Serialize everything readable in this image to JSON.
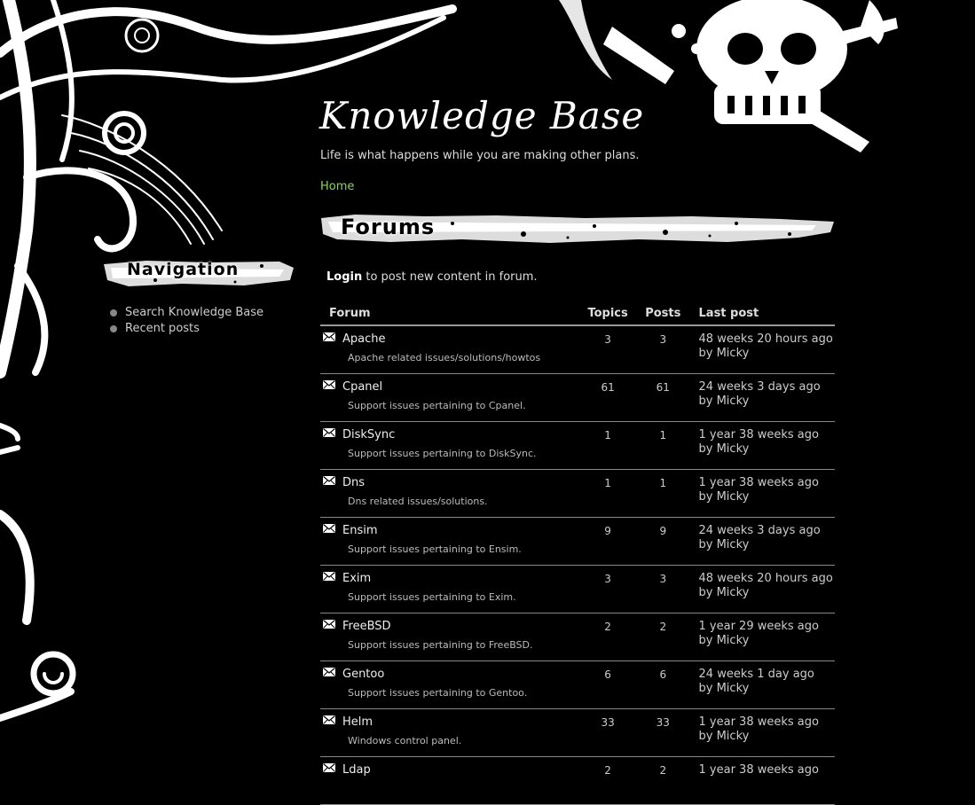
{
  "site": {
    "title": "Knowledge Base",
    "slogan": "Life is what happens while you are making other plans.",
    "breadcrumb": "Home"
  },
  "sidebar": {
    "heading": "Navigation",
    "items": [
      {
        "label": "Search Knowledge Base"
      },
      {
        "label": "Recent posts"
      }
    ]
  },
  "main": {
    "heading": "Forums",
    "login_link": "Login",
    "login_suffix": " to post new content in forum.",
    "table": {
      "headers": {
        "forum": "Forum",
        "topics": "Topics",
        "posts": "Posts",
        "last": "Last post"
      },
      "rows": [
        {
          "name": "Apache",
          "desc": "Apache related issues/solutions/howtos",
          "topics": "3",
          "posts": "3",
          "last": "48 weeks 20 hours ago",
          "by": "by Micky"
        },
        {
          "name": "Cpanel",
          "desc": "Support issues pertaining to Cpanel.",
          "topics": "61",
          "posts": "61",
          "last": "24 weeks 3 days ago",
          "by": "by Micky"
        },
        {
          "name": "DiskSync",
          "desc": "Support issues pertaining to DiskSync.",
          "topics": "1",
          "posts": "1",
          "last": "1 year 38 weeks ago",
          "by": "by Micky"
        },
        {
          "name": "Dns",
          "desc": "Dns related issues/solutions.",
          "topics": "1",
          "posts": "1",
          "last": "1 year 38 weeks ago",
          "by": "by Micky"
        },
        {
          "name": "Ensim",
          "desc": "Support issues pertaining to Ensim.",
          "topics": "9",
          "posts": "9",
          "last": "24 weeks 3 days ago",
          "by": "by Micky"
        },
        {
          "name": "Exim",
          "desc": "Support issues pertaining to Exim.",
          "topics": "3",
          "posts": "3",
          "last": "48 weeks 20 hours ago",
          "by": "by Micky"
        },
        {
          "name": "FreeBSD",
          "desc": "Support issues pertaining to FreeBSD.",
          "topics": "2",
          "posts": "2",
          "last": "1 year 29 weeks ago",
          "by": "by Micky"
        },
        {
          "name": "Gentoo",
          "desc": "Support issues pertaining to Gentoo.",
          "topics": "6",
          "posts": "6",
          "last": "24 weeks 1 day ago",
          "by": "by Micky"
        },
        {
          "name": "Helm",
          "desc": "Windows control panel.",
          "topics": "33",
          "posts": "33",
          "last": "1 year 38 weeks ago",
          "by": "by Micky"
        },
        {
          "name": "Ldap",
          "desc": "",
          "topics": "2",
          "posts": "2",
          "last": "1 year 38 weeks ago",
          "by": ""
        }
      ]
    }
  },
  "icons": {
    "forum_row": "envelope-icon",
    "sidebar_bullet": "bullet-icon"
  },
  "colors": {
    "background": "#000000",
    "link_green": "#8fd163",
    "text": "#cccccc"
  }
}
